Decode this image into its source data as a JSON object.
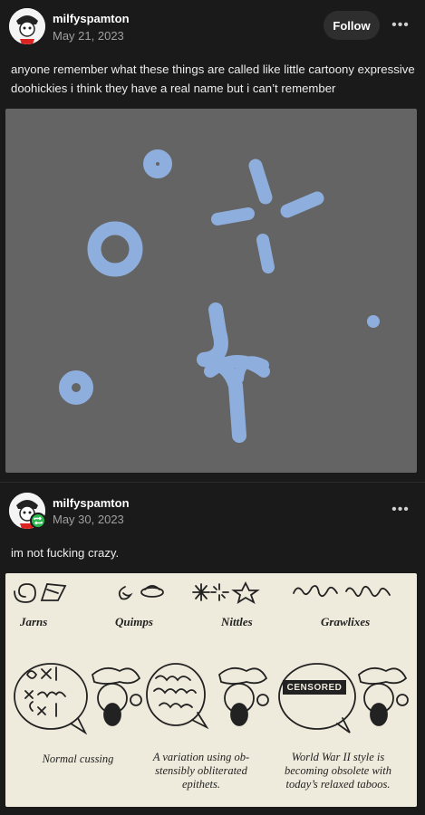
{
  "posts": [
    {
      "username": "milfyspamton",
      "date": "May 21, 2023",
      "follow_label": "Follow",
      "more_label": "•••",
      "text": "anyone remember what these things are called   like little cartoony expressive doohickies i think they have a real name but i can’t remember"
    },
    {
      "username": "milfyspamton",
      "date": "May 30, 2023",
      "more_label": "•••",
      "text": "im not fucking crazy."
    }
  ],
  "comic": {
    "categories": [
      "Jarns",
      "Quimps",
      "Nittles",
      "Grawlixes"
    ],
    "censored_label": "CENSORED",
    "captions": [
      "Normal cussing",
      "A variation using ob-\nstensibly obliterated\nepithets.",
      "World War II style is\nbecoming obsolete with\ntoday’s relaxed taboos."
    ]
  },
  "colors": {
    "background": "#1a1a1a",
    "sparkle_blue": "#8eaedd",
    "image_gray": "#646464",
    "comic_paper": "#efebdc",
    "reblog_green": "#2db84d"
  }
}
